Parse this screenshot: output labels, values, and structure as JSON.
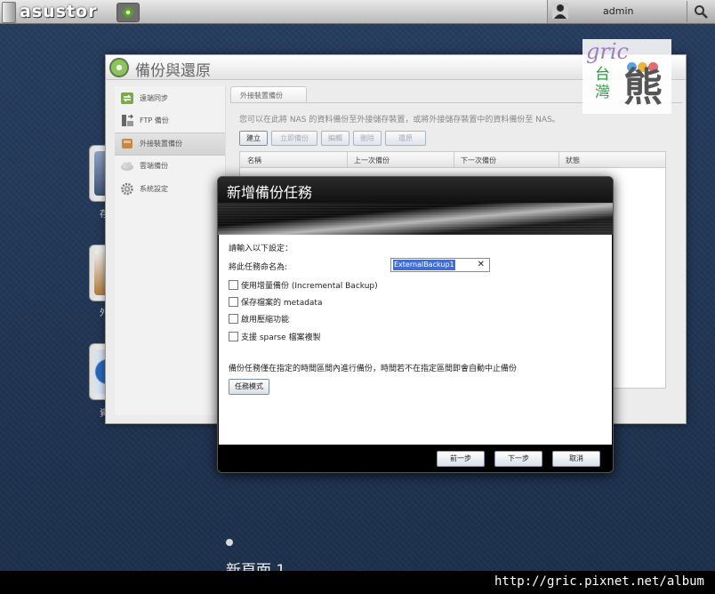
{
  "topbar": {
    "logo": "asustor",
    "user": "admin"
  },
  "window": {
    "title": "備份與還原",
    "sidebar": [
      {
        "label": "遠端同步",
        "icon": "remote-sync-icon"
      },
      {
        "label": "FTP 備份",
        "icon": "ftp-icon"
      },
      {
        "label": "外接裝置備份",
        "icon": "external-device-icon"
      },
      {
        "label": "雲端備份",
        "icon": "cloud-icon"
      },
      {
        "label": "系統設定",
        "icon": "gear-icon"
      }
    ],
    "active_sidebar_index": 2,
    "tab": "外接裝置備份",
    "description": "您可以在此將 NAS 的資料備份至外接儲存裝置，或將外接儲存裝置中的資料備份至 NAS。",
    "toolbar": {
      "create": "建立",
      "backup_now": "立即備份",
      "edit": "編輯",
      "delete": "刪除",
      "restore": "還原"
    },
    "columns": [
      "名稱",
      "上一次備份",
      "下一次備份",
      "狀態"
    ]
  },
  "watermark": {
    "g": "gric",
    "tai": "台",
    "wan": "灣",
    "xiong": "熊"
  },
  "dialog": {
    "title": "新增備份任務",
    "prompt": "請輸入以下設定：",
    "task_name_label": "將此任務命名為:",
    "task_name_value": "ExternalBackup1",
    "options": [
      {
        "label": "使用增量備份 (Incremental Backup)",
        "checked": false
      },
      {
        "label": "保存檔案的 metadata",
        "checked": false
      },
      {
        "label": "啟用壓縮功能",
        "checked": false
      },
      {
        "label": "支援 sparse 檔案複製",
        "checked": false
      }
    ],
    "note": "備份任務僅在指定的時間區間內進行備份，時間若不在指定區間即會自動中止備份",
    "task_mode_button": "任務模式",
    "buttons": {
      "prev": "前一步",
      "next": "下一步",
      "cancel": "取消"
    }
  },
  "desktop": {
    "labels": [
      "存",
      "外",
      "資"
    ],
    "page_label": "新頁面 1"
  },
  "footer_url": "http://gric.pixnet.net/album"
}
